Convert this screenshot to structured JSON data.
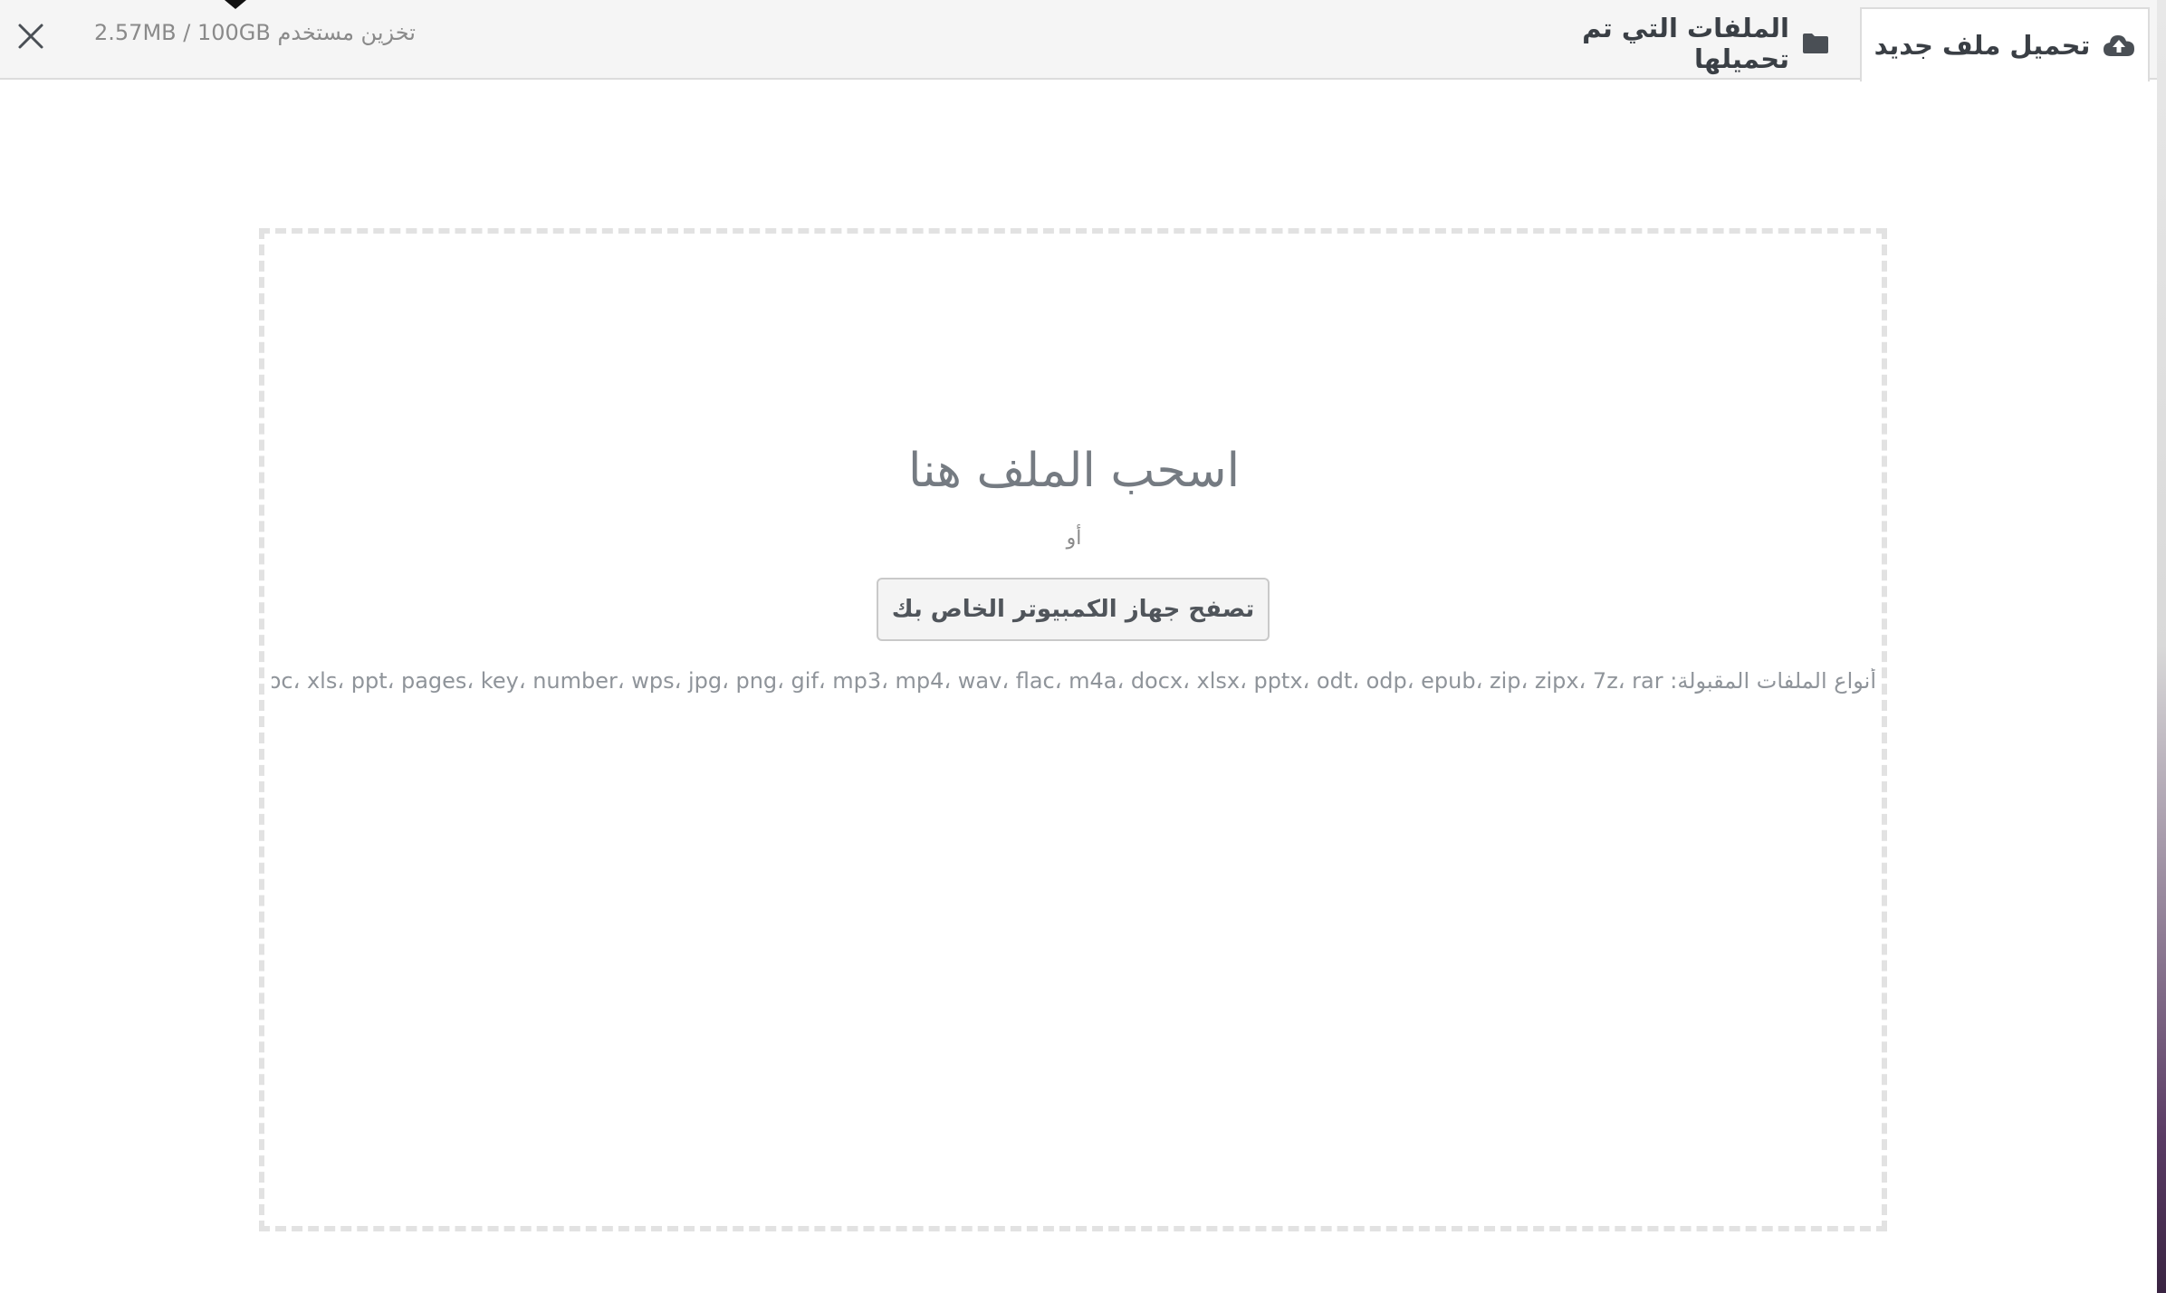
{
  "header": {
    "storage_used": "2.57MB / 100GB",
    "storage_label": "تخزين مستخدم",
    "tabs": [
      {
        "label": "تحميل ملف جديد",
        "icon": "cloud-upload-icon",
        "active": true
      },
      {
        "label": "الملفات التي تم تحميلها",
        "icon": "folder-icon",
        "active": false
      }
    ]
  },
  "dropzone": {
    "title": "اسحب الملف هنا",
    "or_text": "أو",
    "browse_label": "تصفح جهاز الكمبيوتر الخاص بك",
    "accepted_label": "أنواع الملفات المقبولة:",
    "accepted_types": "txt، pdf، doc، xls، ppt، pages، key، number، wps، jpg، png، gif، mp3، mp4، wav، flac، m4a، docx، xlsx، pptx، odt، odp، epub، zip، zipx، 7z، rar"
  },
  "colors": {
    "header_bg": "#f5f5f5",
    "text_dark": "#3a3f45",
    "text_muted": "#8a8a8a",
    "dash_border": "#e2e2e2"
  }
}
